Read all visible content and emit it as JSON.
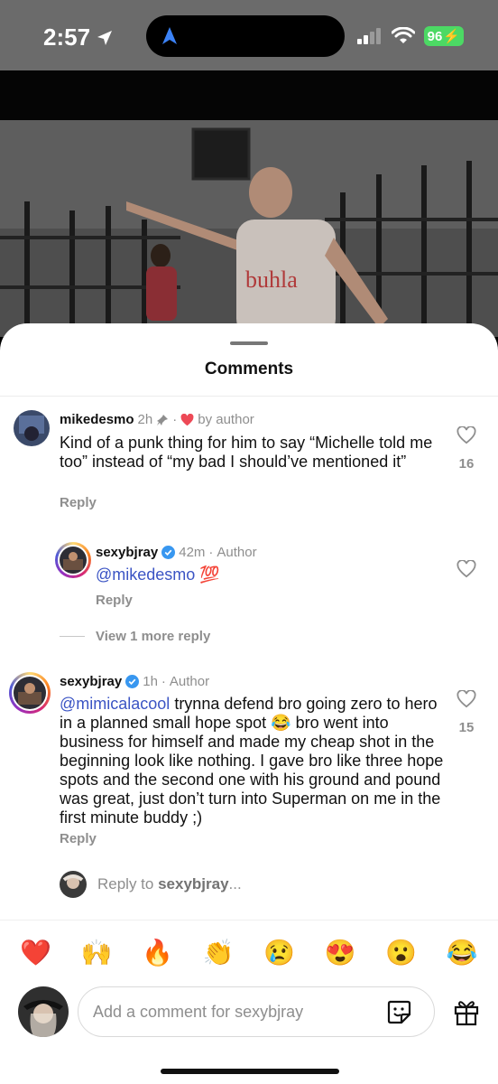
{
  "status_bar": {
    "time": "2:57",
    "battery": "96"
  },
  "sheet": {
    "title": "Comments"
  },
  "comments": [
    {
      "username": "mikedesmo",
      "time": "2h",
      "liked_by": "by author",
      "text": "Kind of a punk thing for him to say “Michelle told me too” instead of “my bad I should’ve mentioned it”",
      "reply_label": "Reply",
      "likes": "16",
      "replies": [
        {
          "username": "sexybjray",
          "time": "42m",
          "role": "Author",
          "mention": "@mikedesmo",
          "emoji": "💯",
          "reply_label": "Reply"
        }
      ],
      "view_more": "View 1 more reply"
    },
    {
      "username": "sexybjray",
      "time": "1h",
      "role": "Author",
      "mention": "@mimicalacool",
      "text_part1": " trynna defend bro going zero to hero in a planned small hope spot ",
      "emoji": "😂",
      "text_part2": " bro went into business for himself and made my cheap shot in the beginning look like nothing. I gave bro like three hope spots and the second one with his ground and pound was great, just don’t turn into Superman on me in the first minute buddy ;)",
      "reply_label": "Reply",
      "likes": "15"
    }
  ],
  "reply_to": {
    "prefix": "Reply to ",
    "username": "sexybjray",
    "suffix": "..."
  },
  "emoji_reactions": [
    "❤️",
    "🙌",
    "🔥",
    "👏",
    "😢",
    "😍",
    "😮",
    "😂"
  ],
  "composer": {
    "placeholder": "Add a comment for sexybjray"
  },
  "icons": {
    "location": "location-arrow-icon",
    "signal": "cellular-signal-icon",
    "wifi": "wifi-icon",
    "battery": "battery-icon",
    "pin": "pin-icon",
    "heart_small": "heart-filled-icon",
    "verified": "verified-badge-icon",
    "like": "heart-outline-icon",
    "sticker": "sticker-icon",
    "gift": "gift-icon"
  },
  "colors": {
    "accent_mention": "#3b54c4",
    "verified": "#3897f0",
    "heart": "#ed4956",
    "battery": "#4cd964"
  }
}
